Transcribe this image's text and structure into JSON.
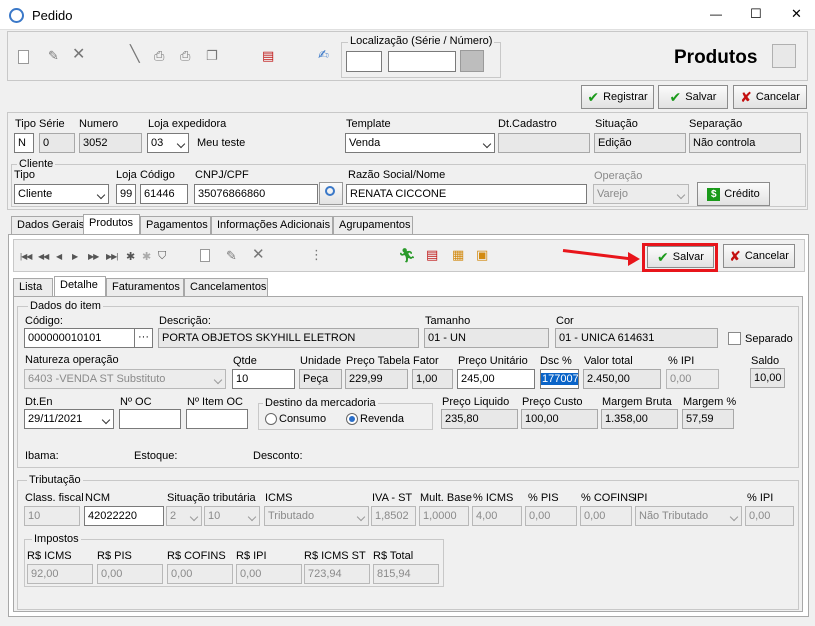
{
  "window": {
    "title": "Pedido",
    "minimize": "—",
    "maximize": "☐",
    "close": "✕"
  },
  "header": {
    "localizacao_label": "Localização (Série / Número)",
    "section_title": "Produtos"
  },
  "actions": {
    "registrar": "Registrar",
    "salvar": "Salvar",
    "cancelar": "Cancelar"
  },
  "pedido": {
    "tipo_label": "Tipo",
    "tipo": "N",
    "serie_label": "Série",
    "serie": "0",
    "numero_label": "Numero",
    "numero": "3052",
    "loja_exp_label": "Loja expedidora",
    "loja_exp": "03",
    "loja_exp_nome": "Meu teste",
    "template_label": "Template",
    "template": "Venda",
    "dt_cadastro_label": "Dt.Cadastro",
    "dt_cadastro": "",
    "situacao_label": "Situação",
    "situacao": "Edição",
    "separacao_label": "Separação",
    "separacao": "Não controla"
  },
  "cliente": {
    "group_label": "Cliente",
    "tipo_label": "Tipo",
    "tipo": "Cliente",
    "loja_label": "Loja",
    "loja": "99",
    "codigo_label": "Código",
    "codigo": "61446",
    "cnpj_label": "CNPJ/CPF",
    "cnpj": "35076866860",
    "razao_label": "Razão Social/Nome",
    "razao": "RENATA CICCONE",
    "operacao_label": "Operação",
    "operacao": "Varejo",
    "credito_label": "Crédito"
  },
  "main_tabs": [
    "Dados Gerais",
    "Produtos",
    "Pagamentos",
    "Informações Adicionais",
    "Agrupamentos"
  ],
  "product_actions": {
    "salvar": "Salvar",
    "cancelar": "Cancelar"
  },
  "sub_tabs": [
    "Lista",
    "Detalhe",
    "Faturamentos",
    "Cancelamentos"
  ],
  "item": {
    "group_label": "Dados do item",
    "codigo_label": "Código:",
    "codigo": "000000010101",
    "lookup": "···",
    "descricao_label": "Descrição:",
    "descricao": "PORTA OBJETOS SKYHILL ELETRON",
    "tamanho_label": "Tamanho",
    "tamanho": "01 - UN",
    "cor_label": "Cor",
    "cor": "01 - UNICA 614631",
    "separado_label": "Separado",
    "natureza_label": "Natureza operação",
    "natureza": "6403 -VENDA ST Substituto",
    "qtde_label": "Qtde",
    "qtde": "10",
    "unidade_label": "Unidade",
    "unidade": "Peça",
    "preco_tabela_label": "Preço Tabela",
    "preco_tabela": "229,99",
    "fator_label": "Fator",
    "fator": "1,00",
    "preco_unit_label": "Preço Unitário",
    "preco_unit": "245,00",
    "dsc_label": "Dsc %",
    "dsc": "177007",
    "valor_total_label": "Valor total",
    "valor_total": "2.450,00",
    "ipi_label": "% IPI",
    "ipi": "0,00",
    "saldo_label": "Saldo",
    "saldo": "10,00",
    "dt_en_label": "Dt.En",
    "dt_en": "29/11/2021",
    "n_oc_label": "Nº OC",
    "n_oc": "",
    "n_item_oc_label": "Nº Item OC",
    "n_item_oc": "",
    "destino_label": "Destino da mercadoria",
    "consumo_label": "Consumo",
    "revenda_label": "Revenda",
    "preco_liquido_label": "Preço Liquido",
    "preco_liquido": "235,80",
    "preco_custo_label": "Preço Custo",
    "preco_custo": "100,00",
    "margem_bruta_label": "Margem Bruta",
    "margem_bruta": "1.358,00",
    "margem_pct_label": "Margem %",
    "margem_pct": "57,59",
    "ibama_label": "Ibama:",
    "estoque_label": "Estoque:",
    "desconto_label": "Desconto:"
  },
  "tributacao": {
    "group_label": "Tributação",
    "class_fiscal_label": "Class. fiscal",
    "class_fiscal": "10",
    "ncm_label": "NCM",
    "ncm": "42022220",
    "sit_trib_label": "Situação tributária",
    "sit_trib_a": "2",
    "sit_trib_b": "10",
    "icms_label": "ICMS",
    "icms": "Tributado",
    "iva_st_label": "IVA - ST",
    "iva_st": "1,8502",
    "mult_base_label": "Mult. Base",
    "mult_base": "1,0000",
    "pct_icms_label": "% ICMS",
    "pct_icms": "4,00",
    "pct_pis_label": "% PIS",
    "pct_pis": "0,00",
    "pct_cofins_label": "% COFINS",
    "pct_cofins": "0,00",
    "ipi_label": "IPI",
    "ipi": "Não Tributado",
    "pct_ipi_label": "% IPI",
    "pct_ipi": "0,00"
  },
  "impostos": {
    "group_label": "Impostos",
    "icms_label": "R$ ICMS",
    "icms": "92,00",
    "pis_label": "R$ PIS",
    "pis": "0,00",
    "cofins_label": "R$ COFINS",
    "cofins": "0,00",
    "ipi_label": "R$ IPI",
    "ipi": "0,00",
    "icms_st_label": "R$ ICMS ST",
    "icms_st": "723,94",
    "total_label": "R$ Total",
    "total": "815,94"
  },
  "colors": {
    "highlight": "#e8151b",
    "accent_ok": "#1a9a1a",
    "accent_cancel": "#c41010"
  }
}
